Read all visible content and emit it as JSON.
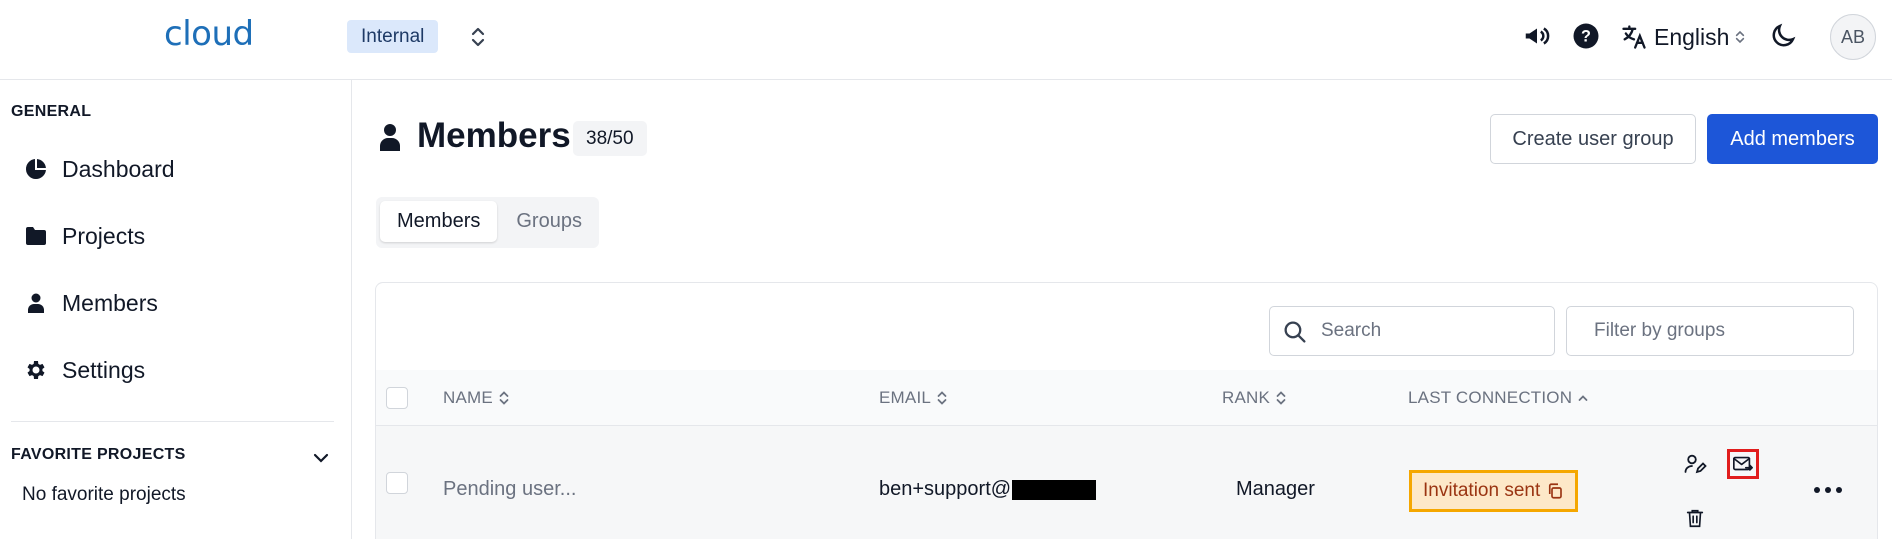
{
  "header": {
    "logo": "cloud",
    "org_name": "Internal",
    "language": "English",
    "avatar_initials": "AB"
  },
  "sidebar": {
    "general_label": "GENERAL",
    "items": [
      {
        "label": "Dashboard",
        "icon": "pie-chart-icon"
      },
      {
        "label": "Projects",
        "icon": "folder-icon"
      },
      {
        "label": "Members",
        "icon": "user-icon"
      },
      {
        "label": "Settings",
        "icon": "gear-icon"
      }
    ],
    "favorites_label": "FAVORITE PROJECTS",
    "favorites_empty": "No favorite projects"
  },
  "page": {
    "title": "Members",
    "count": "38/50",
    "create_group_label": "Create user group",
    "add_members_label": "Add members",
    "tabs": [
      {
        "label": "Members",
        "active": true
      },
      {
        "label": "Groups",
        "active": false
      }
    ]
  },
  "toolbar": {
    "search_placeholder": "Search",
    "filter_placeholder": "Filter by groups"
  },
  "table": {
    "columns": [
      "NAME",
      "EMAIL",
      "RANK",
      "LAST CONNECTION"
    ],
    "rows": [
      {
        "name": "Pending user...",
        "email": "ben+support@",
        "rank": "Manager",
        "status": "Invitation sent"
      }
    ]
  },
  "colors": {
    "primary": "#1d56d8",
    "logo": "#1e6fb8",
    "status_border": "#f5a700",
    "status_bg": "#fde8c8",
    "highlight": "#e11d1d"
  }
}
